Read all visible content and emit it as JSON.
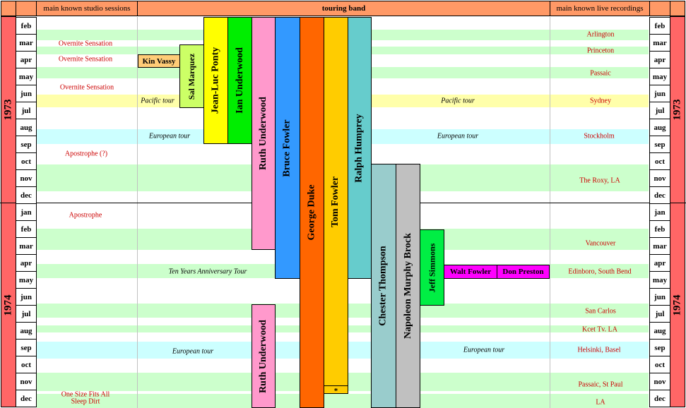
{
  "header": {
    "studio": "main known studio sessions",
    "band": "touring band",
    "live": "main known live recordings"
  },
  "years": [
    "1973",
    "1974"
  ],
  "months": [
    "feb",
    "mar",
    "apr",
    "may",
    "jun",
    "jul",
    "aug",
    "sep",
    "oct",
    "nov",
    "dec",
    "jan",
    "feb",
    "mar",
    "apr",
    "may",
    "jun",
    "jul",
    "aug",
    "sep",
    "oct",
    "nov",
    "dec"
  ],
  "studio_sessions": [
    {
      "text": "Overnite Sensation"
    },
    {
      "text": "Overnite Sensation"
    },
    {
      "text": "Overnite Sensation"
    },
    {
      "text": "Apostrophe (?)"
    },
    {
      "text": "Apostrophe"
    },
    {
      "text": "One Size Fits All"
    },
    {
      "text": "Sleep Dirt"
    }
  ],
  "tours": [
    {
      "name": "Pacific tour"
    },
    {
      "name": "European tour"
    },
    {
      "name": "Ten Years Anniversary Tour"
    },
    {
      "name": "European tour"
    }
  ],
  "live_recordings": [
    {
      "text": "Arlington"
    },
    {
      "text": "Princeton"
    },
    {
      "text": "Passaic"
    },
    {
      "text": "Sydney"
    },
    {
      "text": "Stockholm"
    },
    {
      "text": "The Roxy, LA"
    },
    {
      "text": "Vancouver"
    },
    {
      "text": "Edinboro, South Bend"
    },
    {
      "text": "San Carlos"
    },
    {
      "text": "Kcet Tv. LA"
    },
    {
      "text": "Helsinki, Basel"
    },
    {
      "text": "Passaic, St Paul"
    },
    {
      "text": "LA"
    }
  ],
  "members": [
    {
      "name": "Kin Vassy",
      "color": "#ffcc77"
    },
    {
      "name": "Sal Marquez",
      "color": "#ccff66"
    },
    {
      "name": "Jean-Luc Ponty",
      "color": "#ffff00"
    },
    {
      "name": "Ian Underwood",
      "color": "#00ee00"
    },
    {
      "name": "Ruth Underwood",
      "color": "#ff99cc"
    },
    {
      "name": "Bruce Fowler",
      "color": "#3399ff"
    },
    {
      "name": "George Duke",
      "color": "#ff6600"
    },
    {
      "name": "Tom Fowler",
      "color": "#ffcc00"
    },
    {
      "name": "Ralph Humprey",
      "color": "#66cccc"
    },
    {
      "name": "Chester Thompson",
      "color": "#99cccc"
    },
    {
      "name": "Napoleon Murphy Brock",
      "color": "#c0c0c0"
    },
    {
      "name": "Jeff Simmons",
      "color": "#00ee44"
    },
    {
      "name": "Walt Fowler",
      "color": "#ff00ff"
    },
    {
      "name": "Don Preston",
      "color": "#ff00ff"
    },
    {
      "name": "Ruth Underwood",
      "color": "#ff99cc"
    }
  ],
  "footnote_mark": "*",
  "colors": {
    "header": "#ff9966",
    "year": "#ff6666",
    "band_green": "#ccffcc",
    "band_yellow": "#ffffaa",
    "band_cyan": "#ccffff",
    "text_red": "#cc0000"
  }
}
